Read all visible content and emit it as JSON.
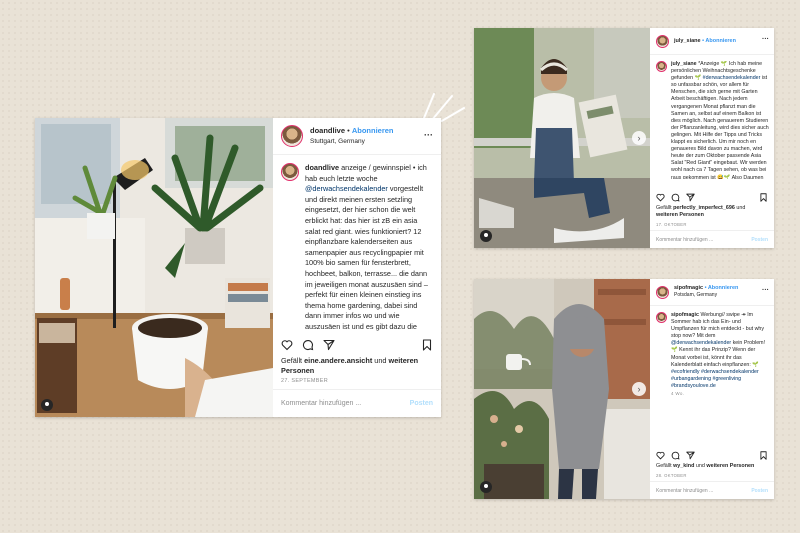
{
  "posts": {
    "left": {
      "username": "doandlive",
      "follow_label": "Abonnieren",
      "location": "Stuttgart, Germany",
      "more_label": "···",
      "caption_user": "doandlive",
      "caption_1": "anzeige / gewinnspiel • ich hab euch letzte woche",
      "mention_1": "@derwachsendekalender",
      "caption_2": "vorgestellt und direkt meinen ersten setzling eingesetzt, der hier schon die welt erblickt hat: das hier ist zB ein asia salat red giant. wies funktioniert? 12 einpflanzbare kalenderseiten aus samenpapier aus recyclingpapier mit 100% bio samen für fensterbrett, hochbeet, balkon, terrasse... die dann im jeweiligen monat auszusäen sind – perfekt für einen kleinen einstieg ins thema home gardening, dabei sind dann immer infos wo und wie auszusäen ist und es gibt dazu die monatliche pflanzenpost, ein onlinemagazin mit home gardening",
      "likes_prefix": "Gefällt",
      "likes_user": "eine.andere.ansicht",
      "likes_and": "und",
      "likes_others": "weiteren Personen",
      "date": "27. SEPTEMBER",
      "comment_placeholder": "Kommentar hinzufügen ...",
      "post_label": "Posten"
    },
    "top_right": {
      "username": "july_siane",
      "follow_label": "• Abonnieren",
      "more_label": "···",
      "caption_user": "july_siane",
      "caption_1": "*Anzeige 🌱 Ich hab meine persönlichen Weihnachtsgeschenke gefunden 🌱",
      "mention_1": "#derwachsendekalender",
      "caption_2": "ist so unfassbar schön, vor allem für Menschen, die sich gerne mit Garten Arbeit beschäftigen. Nach jedem vergangenen Monat pflanzt man die Samen an, selbst auf einem Balkon ist dies möglich. Nach genauerem Studieren der Pflanzanleitung, wird dies sicher auch gelingen. Mit Hilfe der Tipps und Tricks klappt es sicherlich. Um mir noch en genaueres Bild davon zu machen, wird heute der zum Oktober passende Asia Salat \"Red Giant\" eingebaut. Wir werden wohl nach ca 7 Tagen sehen, ob was bei raus gekommen ist 😅🌱 Also Daumen drücken 🤞",
      "likes_prefix": "Gefällt",
      "likes_user": "perfectly_imperfect_696",
      "likes_and": "und",
      "likes_others": "weiteren Personen",
      "date": "17. OKTOBER",
      "comment_placeholder": "Kommentar hinzufügen ...",
      "post_label": "Posten"
    },
    "bottom_right": {
      "username": "sipofmagic",
      "follow_label": "• Abonnieren",
      "location": "Potsdam, Germany",
      "more_label": "···",
      "caption_user": "sipofmagic",
      "caption_1": "Werbung// swipe ↠ Im Sommer hab ich das Ein- und Umpflanzen für mich entdeckt - but why stop now? Mit dem",
      "mention_1": "@derwachsendekalender",
      "caption_2": "kein Problem! 🌱 Kennt ihr das Prinzip? Wenn der Monat vorbei ist, könnt ihr das Kalenderblatt einfach einpflanzen: 🌱",
      "hashtags": "#ecofriendly #derwachsendekalender #urbangardening #greenliving #brandsyoulove.de",
      "time_ago": "4 Wo.",
      "likes_prefix": "Gefällt",
      "likes_user": "wy_kind",
      "likes_and": "und",
      "likes_others": "weiteren Personen",
      "date": "28. OKTOBER",
      "comment_placeholder": "Kommentar hinzufügen ...",
      "post_label": "Posten"
    }
  },
  "icons": [
    "heart-icon",
    "comment-icon",
    "share-icon",
    "bookmark-icon",
    "more-icon",
    "user-tag-icon",
    "next-arrow-icon"
  ],
  "colors": {
    "background": "#e9e2d6",
    "link": "#3897f0",
    "mention": "#003569",
    "text": "#262626",
    "muted": "#8e8e8e"
  }
}
